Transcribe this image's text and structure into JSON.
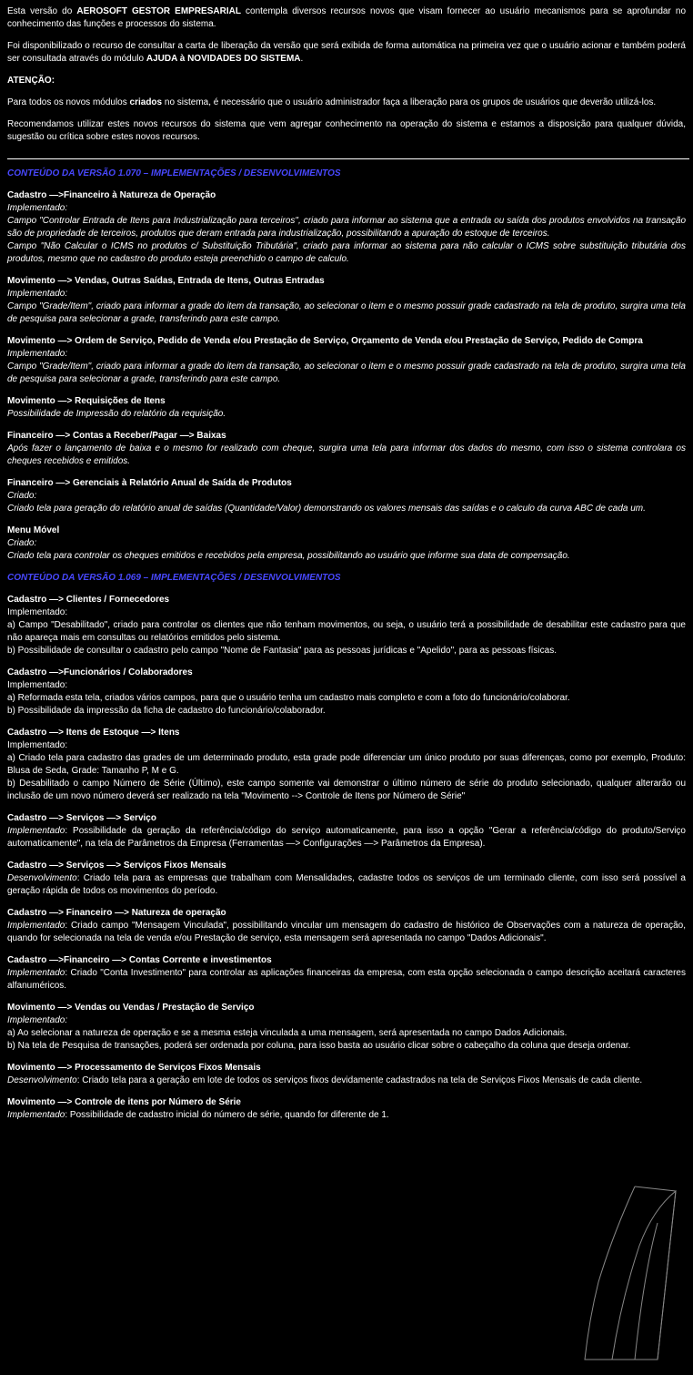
{
  "intro": {
    "p1_a": "Esta versão do ",
    "p1_b": "AEROSOFT GESTOR EMPRESARIAL",
    "p1_c": " contempla diversos recursos novos que visam fornecer ao usuário mecanismos para se aprofundar no conhecimento das funções e processos do sistema.",
    "p2_a": "Foi disponibilizado o recurso de consultar a carta de liberação da versão que será exibida de forma automática na primeira vez que o usuário acionar e também poderá ser consultada através do módulo ",
    "p2_b": "AJUDA à NOVIDADES DO SISTEMA",
    "p2_c": ".",
    "attention_label": "ATENÇÃO:",
    "attention_a": "Para todos os novos módulos ",
    "attention_b": "criados",
    "attention_c": " no sistema, é necessário que o usuário administrador faça a liberação para os grupos de usuários que deverão utilizá-los.",
    "p3": "Recomendamos utilizar estes novos recursos do sistema que vem agregar conhecimento na operação do sistema e estamos a disposição para qualquer dúvida, sugestão ou crítica sobre estes novos recursos."
  },
  "divider": "———————————————————————————————————————————————————————————————————————————",
  "v1070": {
    "header": "CONTEÚDO DA VERSÃO 1.070 – IMPLEMENTAÇÕES / DESENVOLVIMENTOS",
    "s1": {
      "title": "Cadastro —>Financeiro à Natureza de Operação",
      "label": "Implementado:",
      "body1": "Campo \"Controlar Entrada de Itens para Industrialização para terceiros\", criado para informar ao sistema que a entrada ou saída dos produtos envolvidos na transação são de propriedade de terceiros, produtos que deram entrada para industrialização, possibilitando a apuração do estoque de terceiros.",
      "body2": "Campo \"Não Calcular o ICMS no produtos c/ Substituição Tributária\", criado para informar ao sistema para não calcular o ICMS sobre substituição tributária dos produtos, mesmo que no cadastro do produto esteja preenchido o campo de calculo."
    },
    "s2": {
      "title": "Movimento —> Vendas, Outras Saídas, Entrada de Itens, Outras Entradas",
      "label": "Implementado:",
      "body": "Campo \"Grade/Item\", criado para informar a grade do item da transação, ao selecionar o item e o mesmo possuir grade cadastrado na tela de produto, surgira uma tela de pesquisa para selecionar a grade, transferindo para este campo."
    },
    "s3": {
      "title": "Movimento —> Ordem de Serviço, Pedido de Venda e/ou Prestação de Serviço, Orçamento de Venda e/ou Prestação de Serviço, Pedido de Compra",
      "label": "Implementado:",
      "body": "Campo \"Grade/Item\", criado para informar a grade do item da transação, ao selecionar o item e o mesmo possuir grade cadastrado na tela de produto, surgira uma tela de pesquisa para selecionar a grade, transferindo para este campo."
    },
    "s4": {
      "title": "Movimento —> Requisições de Itens",
      "body": "Possibilidade de Impressão do relatório da requisição."
    },
    "s5": {
      "title": "Financeiro —> Contas a Receber/Pagar —> Baixas",
      "body": "Após fazer o lançamento de baixa e o mesmo for realizado com cheque, surgira uma tela para informar dos dados do mesmo, com isso o sistema controlara os cheques recebidos e emitidos."
    },
    "s6": {
      "title": "Financeiro —> Gerenciais à Relatório Anual de Saída de Produtos",
      "label": "Criado:",
      "body": "Criado tela para geração do relatório anual de saídas (Quantidade/Valor) demonstrando os valores mensais das saídas e o calculo da curva ABC de cada um."
    },
    "s7": {
      "title": "Menu Móvel",
      "label": "Criado:",
      "body": "Criado tela para controlar os cheques emitidos e recebidos pela empresa, possibilitando ao usuário que informe sua data de compensação."
    }
  },
  "v1069": {
    "header": "CONTEÚDO DA VERSÃO 1.069 – IMPLEMENTAÇÕES / DESENVOLVIMENTOS",
    "s1": {
      "title": "Cadastro —> Clientes / Fornecedores",
      "label": "Implementado:",
      "body1": "a) Campo \"Desabilitado\", criado para controlar os clientes que não tenham movimentos, ou seja, o usuário terá a possibilidade de desabilitar este cadastro para que não apareça mais em consultas ou relatórios emitidos pelo sistema.",
      "body2": "b) Possibilidade de consultar o cadastro pelo campo \"Nome de Fantasia\" para as pessoas jurídicas e \"Apelido\", para as pessoas físicas."
    },
    "s2": {
      "title": "Cadastro —>Funcionários / Colaboradores",
      "label": "Implementado:",
      "body1": "a) Reformada esta tela, criados vários campos, para que o usuário tenha um cadastro mais completo e com a foto do funcionário/colaborar.",
      "body2": "b) Possibilidade da impressão da ficha de cadastro do funcionário/colaborador."
    },
    "s3": {
      "title": "Cadastro —> Itens de Estoque —> Itens",
      "label": "Implementado:",
      "body1": "a) Criado tela para cadastro das grades de um determinado produto, esta grade pode diferenciar um único produto por suas diferenças, como por exemplo, Produto: Blusa de Seda, Grade: Tamanho P, M e G.",
      "body2": "b) Desabilitado o campo Número de Série (Último), este campo somente vai demonstrar o último número de série do produto selecionado, qualquer alterarão ou inclusão de um novo número deverá ser realizado na tela \"Movimento --> Controle de Itens por Número de Série\""
    },
    "s4": {
      "title": "Cadastro —> Serviços —> Serviço",
      "label": "Implementado",
      "body": ": Possibilidade da geração da referência/código do serviço automaticamente, para isso a opção \"Gerar a referência/código do produto/Serviço automaticamente\", na tela de Parâmetros da Empresa (Ferramentas —> Configurações —> Parâmetros da Empresa)."
    },
    "s5": {
      "title": "Cadastro —> Serviços —> Serviços Fixos Mensais",
      "label": "Desenvolvimento",
      "body": ": Criado tela para as empresas que trabalham com Mensalidades, cadastre todos os serviços de um terminado cliente, com isso será possível a geração rápida de todos os movimentos do período."
    },
    "s6": {
      "title": "Cadastro —> Financeiro —> Natureza de operação",
      "label": "Implementado",
      "body": ": Criado campo \"Mensagem Vinculada\", possibilitando vincular um mensagem do cadastro de histórico de Observações com a natureza de operação, quando for selecionada na tela de venda e/ou Prestação de serviço, esta mensagem será apresentada no campo \"Dados Adicionais\"."
    },
    "s7": {
      "title": "Cadastro —>Financeiro —> Contas Corrente e investimentos",
      "label": "Implementado",
      "body": ": Criado \"Conta Investimento\" para controlar as aplicações financeiras da empresa, com esta opção selecionada o campo descrição aceitará caracteres alfanuméricos."
    },
    "s8": {
      "title": "Movimento —> Vendas ou Vendas / Prestação de Serviço",
      "label": "Implementado:",
      "body1": "a) Ao selecionar a natureza de operação e se a mesma esteja vinculada a uma mensagem, será apresentada no campo Dados Adicionais.",
      "body2": "b) Na tela de Pesquisa de transações, poderá ser ordenada por coluna, para isso basta ao usuário clicar sobre o cabeçalho da coluna que deseja ordenar."
    },
    "s9": {
      "title": "Movimento —> Processamento de Serviços Fixos Mensais",
      "label": "Desenvolvimento",
      "body": ": Criado tela para a geração em lote de todos os serviços fixos devidamente cadastrados na tela de Serviços Fixos Mensais de cada cliente."
    },
    "s10": {
      "title": "Movimento —> Controle de itens por Número de Série",
      "label": "Implementado",
      "body": ": Possibilidade de cadastro inicial do número de série, quando for diferente de 1."
    }
  }
}
